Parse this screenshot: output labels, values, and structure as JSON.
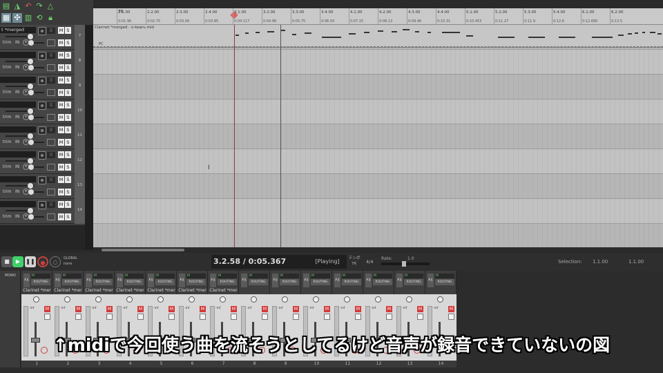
{
  "tcp": {
    "first_track_name": "t *merged",
    "tracks": [
      {
        "num": "7",
        "name": "t *merged"
      },
      {
        "num": "8",
        "name": ""
      },
      {
        "num": "9",
        "name": ""
      },
      {
        "num": "10",
        "name": ""
      },
      {
        "num": "11",
        "name": ""
      },
      {
        "num": "12",
        "name": ""
      },
      {
        "num": "13",
        "name": ""
      },
      {
        "num": "14",
        "name": ""
      }
    ],
    "m_label": "M",
    "s_label": "S",
    "in_label": "IN",
    "trim_label": "trim"
  },
  "ruler": {
    "tempo_marker": "76",
    "bars": [
      {
        "label": "2.1.00",
        "time": "0:01.96"
      },
      {
        "label": "2.2.00",
        "time": "0:02.75"
      },
      {
        "label": "2.3.00",
        "time": "0:03.06"
      },
      {
        "label": "2.4.00",
        "time": "0:03.85"
      },
      {
        "label": "3.1.00",
        "time": "0:04.117"
      },
      {
        "label": "3.2.00",
        "time": "0:04.96"
      },
      {
        "label": "3.3.00",
        "time": "0:05.75"
      },
      {
        "label": "3.4.00",
        "time": "0:06.54"
      },
      {
        "label": "4.1.00",
        "time": "0:07.15"
      },
      {
        "label": "4.2.00",
        "time": "0:08.13"
      },
      {
        "label": "4.3.00",
        "time": "0:09.46"
      },
      {
        "label": "4.4.00",
        "time": "0:10.31"
      },
      {
        "label": "5.1.00",
        "time": "0:10.453"
      },
      {
        "label": "5.2.00",
        "time": "0:11.27"
      },
      {
        "label": "5.3.00",
        "time": "0:11.9"
      },
      {
        "label": "5.4.00",
        "time": "0:12.6"
      },
      {
        "label": "6.1.00",
        "time": "0:12.690"
      },
      {
        "label": "6.2.00",
        "time": "0:13.5"
      }
    ]
  },
  "midi_item": {
    "name": "Clarinet *merged - o-kearu.mid",
    "pc_label": "PC"
  },
  "transport": {
    "global_label": "GLOBAL",
    "global_sub": "none",
    "time_display": "3.2.58 / 0:05.367",
    "state": "[Playing]",
    "bpm_label": "テンポ",
    "bpm": "76",
    "time_signature": "4/4",
    "rate_label": "Rate:",
    "rate_value": "1.0",
    "selection_label": "Selection:",
    "selection_start": "1.1.00",
    "selection_end": "1.1.00"
  },
  "mixer": {
    "master_mono": "MONO",
    "fx_label": "FX",
    "routing_label": "ROUTING",
    "m_label": "M",
    "db_label": "-inf",
    "strips": [
      {
        "num": "1",
        "name": "Clarinet *mer"
      },
      {
        "num": "2",
        "name": "Clarinet *mer"
      },
      {
        "num": "3",
        "name": "Clarinet *mer"
      },
      {
        "num": "4",
        "name": "Clarinet *mer"
      },
      {
        "num": "5",
        "name": "Clarinet *mer"
      },
      {
        "num": "6",
        "name": "Clarinet *mer"
      },
      {
        "num": "7",
        "name": "Clarinet *mer"
      },
      {
        "num": "8",
        "name": ""
      },
      {
        "num": "9",
        "name": ""
      },
      {
        "num": "10",
        "name": ""
      },
      {
        "num": "11",
        "name": ""
      },
      {
        "num": "12",
        "name": ""
      },
      {
        "num": "13",
        "name": ""
      },
      {
        "num": "14",
        "name": ""
      }
    ]
  },
  "subtitle": "↑midiで今回使う曲を流そうとしてるけど音声が録音できていないの図",
  "colors": {
    "play": "#3fd06a",
    "mute_active": "#d23a3a",
    "record": "#c84040",
    "arrange_bg": "#b2b2b2"
  },
  "icons": [
    "stop-icon",
    "play-icon",
    "pause-icon",
    "record-icon",
    "repeat-icon"
  ]
}
